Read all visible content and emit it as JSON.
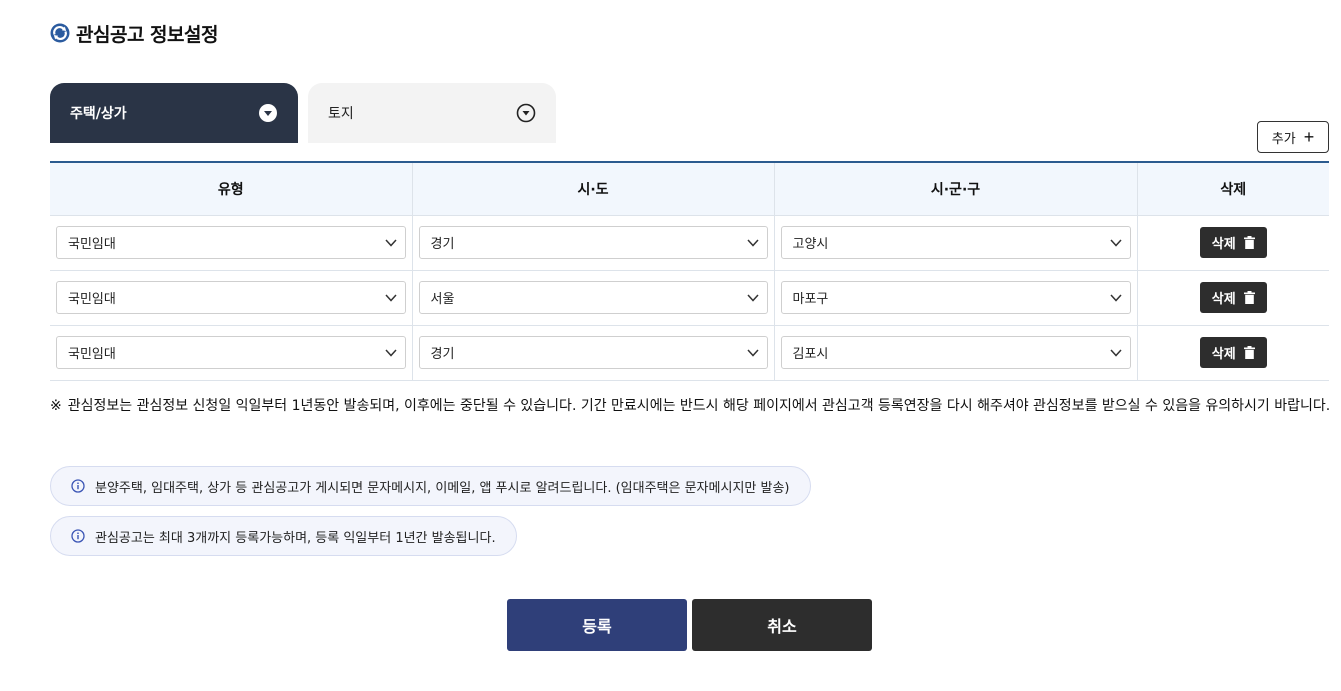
{
  "page_title": "관심공고 정보설정",
  "tabs": [
    {
      "label": "주택/상가",
      "active": true
    },
    {
      "label": "토지",
      "active": false
    }
  ],
  "add_label": "추가",
  "table": {
    "headers": [
      "유형",
      "시·도",
      "시·군·구",
      "삭제"
    ],
    "rows": [
      {
        "type": "국민임대",
        "province": "경기",
        "district": "고양시",
        "delete_label": "삭제"
      },
      {
        "type": "국민임대",
        "province": "서울",
        "district": "마포구",
        "delete_label": "삭제"
      },
      {
        "type": "국민임대",
        "province": "경기",
        "district": "김포시",
        "delete_label": "삭제"
      }
    ]
  },
  "notice": {
    "mark": "※",
    "text": "관심정보는 관심정보 신청일 익일부터 1년동안 발송되며, 이후에는 중단될 수 있습니다. 기간 만료시에는 반드시 해당 페이지에서 관심고객 등록연장을 다시 해주셔야 관심정보를 받으실 수 있음을 유의하시기 바랍니다."
  },
  "info": [
    "분양주택, 임대주택, 상가 등 관심공고가 게시되면 문자메시지, 이메일, 앱 푸시로 알려드립니다. (임대주택은 문자메시지만 발송)",
    "관심공고는 최대 3개까지 등록가능하며, 등록 익일부터 1년간 발송됩니다."
  ],
  "buttons": {
    "register": "등록",
    "cancel": "취소"
  },
  "colors": {
    "tab_active": "#2a3446",
    "table_top_border": "#2b5b8f",
    "header_bg": "#f2f7fd",
    "register": "#2f3f79",
    "cancel": "#2d2d2d",
    "logo": "#2b5b9f"
  },
  "icons": {
    "logo": "refresh-icon",
    "tab": "chevron-circle-down-icon",
    "select": "chevron-down-icon",
    "delete": "trash-icon",
    "info": "info-circle-icon"
  }
}
